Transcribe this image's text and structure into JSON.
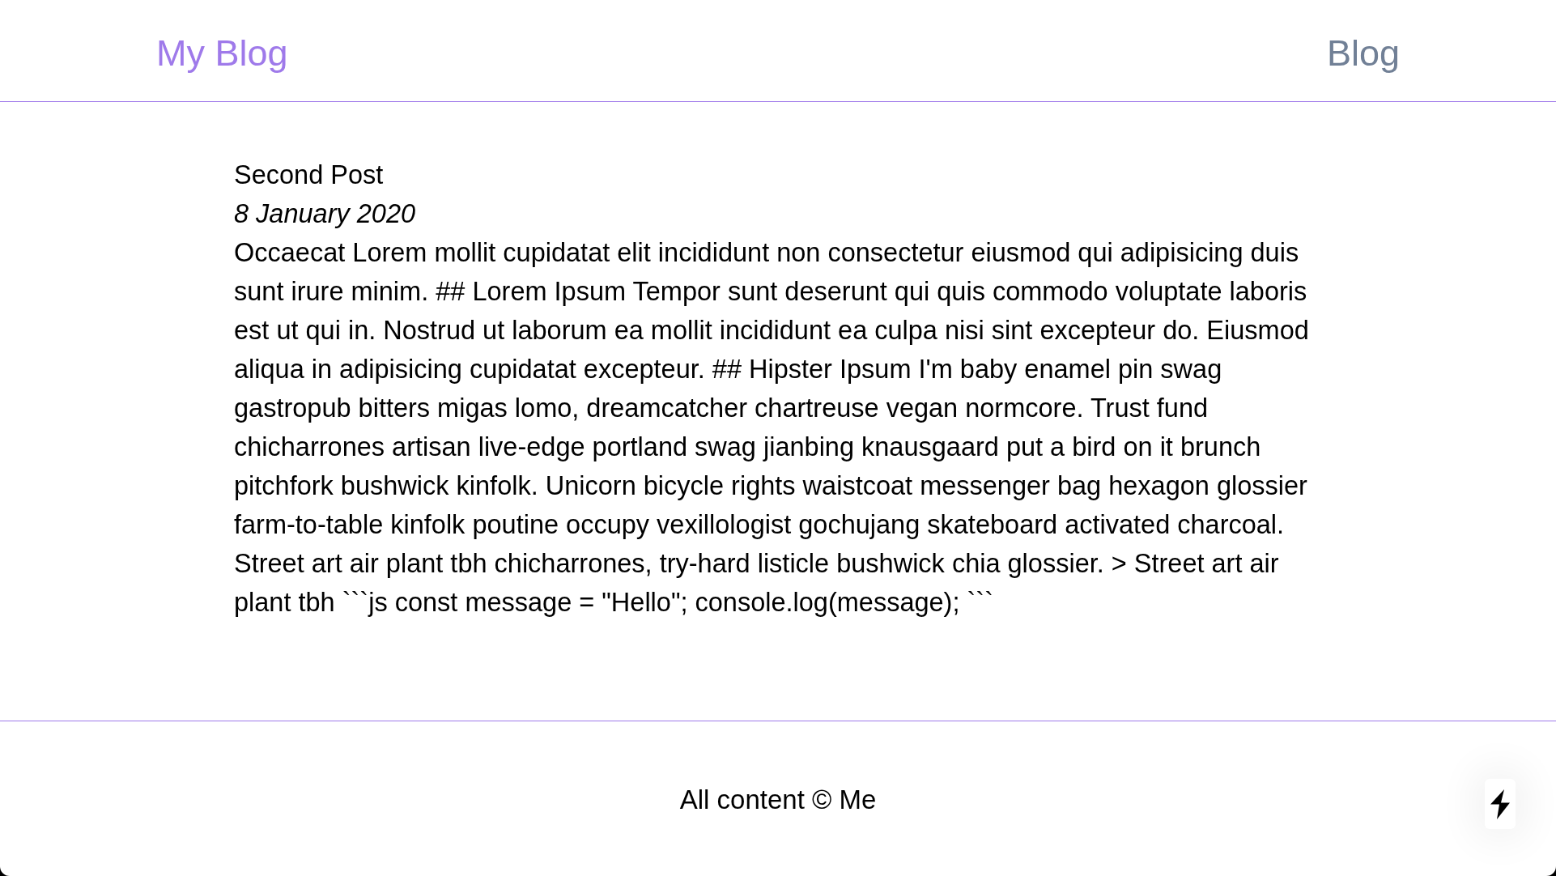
{
  "header": {
    "logo": "My Blog",
    "nav": [
      {
        "label": "Blog"
      }
    ]
  },
  "post": {
    "title": "Second Post",
    "date": "8 January 2020",
    "body": "Occaecat Lorem mollit cupidatat elit incididunt non consectetur eiusmod qui adipisicing duis sunt irure minim. ## Lorem Ipsum Tempor sunt deserunt qui quis commodo voluptate laboris est ut qui in. Nostrud ut laborum ea mollit incididunt ea culpa nisi sint excepteur do. Eiusmod aliqua in adipisicing cupidatat excepteur. ## Hipster Ipsum I'm baby enamel pin swag gastropub bitters migas lomo, dreamcatcher chartreuse vegan normcore. Trust fund chicharrones artisan live-edge portland swag jianbing knausgaard put a bird on it brunch pitchfork bushwick kinfolk. Unicorn bicycle rights waistcoat messenger bag hexagon glossier farm-to-table kinfolk poutine occupy vexillologist gochujang skateboard activated charcoal. Street art air plant tbh chicharrones, try-hard listicle bushwick chia glossier. > Street art air plant tbh ```js const message = \"Hello\"; console.log(message); ```"
  },
  "footer": {
    "text": "All content © Me"
  }
}
